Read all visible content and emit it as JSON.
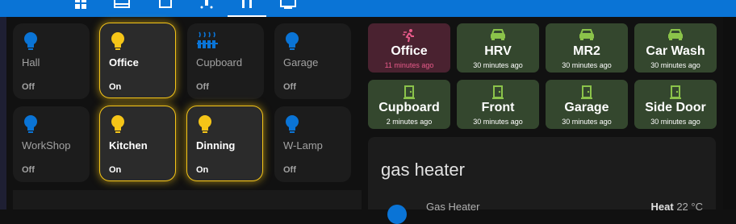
{
  "topbar": {
    "tabs": [
      {
        "icon": "overview-icon"
      },
      {
        "icon": "bed-icon"
      },
      {
        "icon": "sofa-icon"
      },
      {
        "icon": "sprinkler-icon"
      },
      {
        "icon": "people-icon",
        "active": true
      },
      {
        "icon": "monitor-icon"
      }
    ],
    "accent": "#0a74d6"
  },
  "lights": [
    {
      "name": "Hall",
      "state": "Off",
      "icon": "lightbulb-icon",
      "on": false
    },
    {
      "name": "Office",
      "state": "On",
      "icon": "lightbulb-icon",
      "on": true
    },
    {
      "name": "Cupboard",
      "state": "Off",
      "icon": "radiator-icon",
      "on": false
    },
    {
      "name": "Garage",
      "state": "Off",
      "icon": "lightbulb-icon",
      "on": false
    },
    {
      "name": "WorkShop",
      "state": "Off",
      "icon": "lightbulb-icon",
      "on": false
    },
    {
      "name": "Kitchen",
      "state": "On",
      "icon": "lightbulb-icon",
      "on": true
    },
    {
      "name": "Dinning",
      "state": "On",
      "icon": "lightbulb-icon",
      "on": true
    },
    {
      "name": "W-Lamp",
      "state": "Off",
      "icon": "lightbulb-icon",
      "on": false
    }
  ],
  "badges": [
    {
      "name": "Office",
      "time": "11 minutes ago",
      "icon": "motion-icon",
      "alert": true
    },
    {
      "name": "HRV",
      "time": "30 minutes ago",
      "icon": "car-icon",
      "alert": false
    },
    {
      "name": "MR2",
      "time": "30 minutes ago",
      "icon": "car-icon",
      "alert": false
    },
    {
      "name": "Car Wash",
      "time": "30 minutes ago",
      "icon": "car-icon",
      "alert": false
    },
    {
      "name": "Cupboard",
      "time": "2 minutes ago",
      "icon": "door-icon",
      "alert": false
    },
    {
      "name": "Front",
      "time": "30 minutes ago",
      "icon": "door-icon",
      "alert": false
    },
    {
      "name": "Garage",
      "time": "30 minutes ago",
      "icon": "door-icon",
      "alert": false
    },
    {
      "name": "Side Door",
      "time": "30 minutes ago",
      "icon": "door-icon",
      "alert": false
    }
  ],
  "gas_card": {
    "title": "gas heater",
    "entity_name": "Gas Heater",
    "mode": "Heat",
    "temperature": "22 °C"
  },
  "colors": {
    "light_on": "#f5c518",
    "light_off": "#0a74d6",
    "badge_ok": "#34472e",
    "badge_alert": "#4a2230",
    "badge_icon_ok": "#8bc34a",
    "badge_icon_alert": "#e85a8a"
  }
}
